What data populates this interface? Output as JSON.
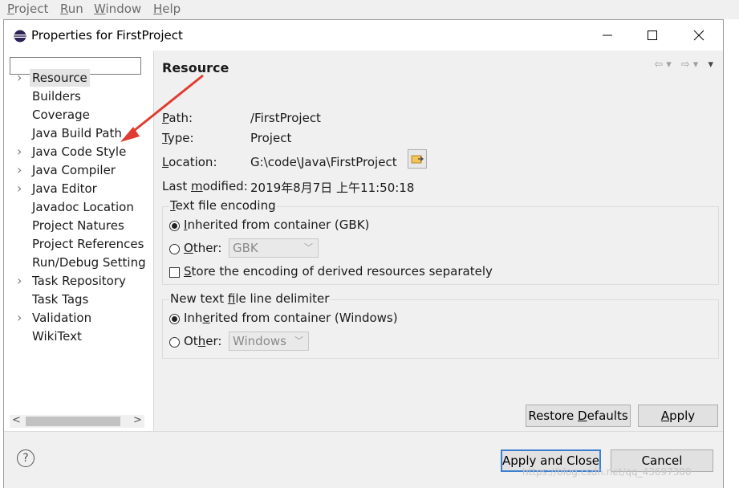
{
  "menubar": {
    "items": [
      {
        "label": "Project",
        "u": "P",
        "rest": "roject"
      },
      {
        "label": "Run",
        "u": "R",
        "rest": "un"
      },
      {
        "label": "Window",
        "u": "W",
        "rest": "indow"
      },
      {
        "label": "Help",
        "u": "H",
        "rest": "elp"
      }
    ]
  },
  "dialog": {
    "title": "Properties for FirstProject",
    "icons": {
      "app": "eclipse-icon",
      "minimize": "minimize-icon",
      "maximize": "maximize-icon",
      "close": "close-icon"
    }
  },
  "tree": {
    "filter_value": "",
    "items": [
      {
        "label": "Resource",
        "expandable": true,
        "selected": true
      },
      {
        "label": "Builders",
        "expandable": false
      },
      {
        "label": "Coverage",
        "expandable": false
      },
      {
        "label": "Java Build Path",
        "expandable": false
      },
      {
        "label": "Java Code Style",
        "expandable": true
      },
      {
        "label": "Java Compiler",
        "expandable": true
      },
      {
        "label": "Java Editor",
        "expandable": true
      },
      {
        "label": "Javadoc Location",
        "expandable": false
      },
      {
        "label": "Project Natures",
        "expandable": false
      },
      {
        "label": "Project References",
        "expandable": false
      },
      {
        "label": "Run/Debug Setting",
        "expandable": false
      },
      {
        "label": "Task Repository",
        "expandable": true
      },
      {
        "label": "Task Tags",
        "expandable": false
      },
      {
        "label": "Validation",
        "expandable": true
      },
      {
        "label": "WikiText",
        "expandable": false
      }
    ]
  },
  "resource": {
    "header": "Resource",
    "path_label_u": "P",
    "path_label_rest": "ath:",
    "path_value": "/FirstProject",
    "type_label_u": "T",
    "type_label_rest": "ype:",
    "type_value": "Project",
    "location_label_u": "L",
    "location_label_rest": "ocation:",
    "location_value": "G:\\code\\Java\\FirstProject",
    "modified_label_pre": "Last ",
    "modified_label_u": "m",
    "modified_label_rest": "odified:",
    "modified_value": "2019年8月7日 上午11:50:18"
  },
  "encoding": {
    "legend_u": "T",
    "legend_rest": "ext file encoding",
    "inherited_u": "I",
    "inherited_rest": "nherited from container (GBK)",
    "other_u": "O",
    "other_rest": "ther:",
    "other_value": "GBK",
    "derived_u": "S",
    "derived_rest": "tore the encoding of derived resources separately",
    "inherited_selected": true,
    "derived_checked": false
  },
  "delimiter": {
    "legend_pre": "New text ",
    "legend_u": "f",
    "legend_rest": "ile line delimiter",
    "inherited_pre": "Inh",
    "inherited_u": "e",
    "inherited_rest": "rited from container (Windows)",
    "other_pre": "Ot",
    "other_u": "h",
    "other_rest": "er:",
    "other_value": "Windows",
    "inherited_selected": true
  },
  "buttons": {
    "restore_pre": "Restore ",
    "restore_u": "D",
    "restore_rest": "efaults",
    "apply_u": "A",
    "apply_rest": "pply",
    "apply_close": "Apply and Close",
    "cancel": "Cancel",
    "help": "?"
  },
  "watermark": "https://blog.csdn.net/qq_43697300",
  "colors": {
    "annotation_arrow": "#e03c31",
    "default_button_border": "#3c7fd0"
  }
}
